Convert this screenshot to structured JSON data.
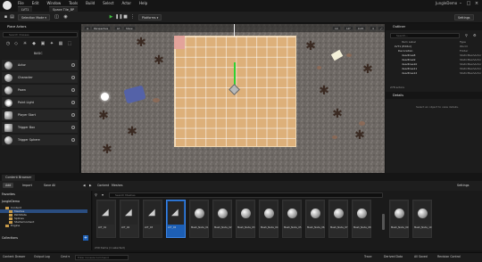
{
  "window": {
    "project_title": "JungleDemo",
    "menu": [
      "File",
      "Edit",
      "Window",
      "Tools",
      "Build",
      "Select",
      "Actor",
      "Help"
    ],
    "tabs": [
      "LVT1",
      "Space Tile_BP"
    ]
  },
  "toolbar": {
    "mode_label": "Selection Mode",
    "platforms_label": "Platforms",
    "settings_label": "Settings"
  },
  "place_actors": {
    "title": "Place Actors",
    "search_placeholder": "Search Classes",
    "category": "BASIC",
    "items": [
      {
        "label": "Actor"
      },
      {
        "label": "Character"
      },
      {
        "label": "Pawn"
      },
      {
        "label": "Point Light"
      },
      {
        "label": "Player Start"
      },
      {
        "label": "Trigger Box"
      },
      {
        "label": "Trigger Sphere"
      }
    ]
  },
  "viewport": {
    "perspective_label": "Perspective",
    "lit_label": "Lit",
    "show_label": "Show",
    "snap_values": [
      "10",
      "10°",
      "0.25",
      "4"
    ]
  },
  "outliner": {
    "title": "Outliner",
    "search_placeholder": "Search...",
    "col_label": "Item Label",
    "col_type": "Type",
    "rows": [
      {
        "name": "LVT1 (Editor)",
        "type": "World"
      },
      {
        "name": "Decoration",
        "type": "Folder"
      },
      {
        "name": "deadtree8",
        "type": "StaticMeshActor"
      },
      {
        "name": "deadtree9",
        "type": "StaticMeshActor"
      },
      {
        "name": "deadtree10",
        "type": "StaticMeshActor"
      },
      {
        "name": "deadtree11",
        "type": "StaticMeshActor"
      },
      {
        "name": "deadtree12",
        "type": "StaticMeshActor"
      }
    ],
    "count": "278 actors"
  },
  "details": {
    "title": "Details",
    "empty_message": "Select an object to view details."
  },
  "content_browser": {
    "tab": "Content Browser",
    "add_label": "Add",
    "import_label": "Import",
    "save_all_label": "Save All",
    "path": [
      "Content",
      "Meshes"
    ],
    "settings_label": "Settings",
    "favorites_label": "Favorites",
    "root_label": "JungleDemo",
    "folders": [
      "Content",
      "Meshes",
      "PathData",
      "Splines",
      "StarterContent",
      "Engine"
    ],
    "selected_folder": "Meshes",
    "collections_label": "Collections",
    "search_placeholder": "Search Meshes",
    "assets": [
      {
        "label": "LVT_01",
        "kind": "texture"
      },
      {
        "label": "LVT_02",
        "kind": "texture"
      },
      {
        "label": "LVT_03",
        "kind": "texture"
      },
      {
        "label": "LVT_04",
        "kind": "texture",
        "selected": true
      },
      {
        "label": "Mesh_Node_01",
        "kind": "mesh"
      },
      {
        "label": "Mesh_Node_02",
        "kind": "mesh"
      },
      {
        "label": "Mesh_Node_03",
        "kind": "mesh"
      },
      {
        "label": "Mesh_Node_04",
        "kind": "mesh"
      },
      {
        "label": "Mesh_Node_05",
        "kind": "mesh"
      },
      {
        "label": "Mesh_Node_06",
        "kind": "mesh"
      },
      {
        "label": "Mesh_Node_07",
        "kind": "mesh"
      },
      {
        "label": "Mesh_Node_08",
        "kind": "mesh"
      },
      {
        "label": "Mesh_Node_09",
        "kind": "mesh"
      },
      {
        "label": "Mesh_Node_10",
        "kind": "mesh"
      }
    ],
    "status": "230 items (1 selected)"
  },
  "statusbar": {
    "content_drawer": "Content Drawer",
    "output_log": "Output Log",
    "cmd": "Cmd",
    "console_placeholder": "Enter Console Command",
    "trace": "Trace",
    "derived_data": "Derived Data",
    "all_saved": "All Saved",
    "revision_control": "Revision Control"
  },
  "colors": {
    "accent": "#1d5fb5",
    "play": "#3fbf3f",
    "grid_fill": "#ddb07a"
  }
}
